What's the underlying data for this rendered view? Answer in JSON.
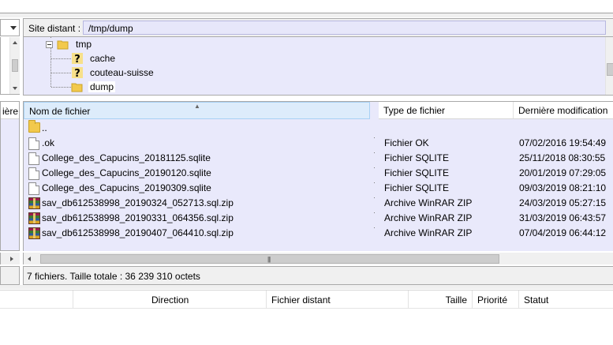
{
  "left_pane": {
    "list_header_partial": "ière"
  },
  "remote": {
    "site_label": "Site distant :",
    "path": "/tmp/dump",
    "tree": [
      {
        "label": "tmp",
        "icon": "folder-icon",
        "selected": false
      },
      {
        "label": "cache",
        "icon": "unknown-folder-icon",
        "selected": false
      },
      {
        "label": "couteau-suisse",
        "icon": "unknown-folder-icon",
        "selected": false
      },
      {
        "label": "dump",
        "icon": "folder-icon",
        "selected": true
      }
    ],
    "columns": {
      "name": "Nom de fichier",
      "type": "Type de fichier",
      "modified": "Dernière modification"
    },
    "files": [
      {
        "name": "..",
        "type": "",
        "modified": "",
        "icon": "folder-icon"
      },
      {
        "name": ".ok",
        "type": "Fichier OK",
        "modified": "07/02/2016 19:54:49",
        "icon": "file-icon"
      },
      {
        "name": "College_des_Capucins_20181125.sqlite",
        "type": "Fichier SQLITE",
        "modified": "25/11/2018 08:30:55",
        "icon": "file-icon"
      },
      {
        "name": "College_des_Capucins_20190120.sqlite",
        "type": "Fichier SQLITE",
        "modified": "20/01/2019 07:29:05",
        "icon": "file-icon"
      },
      {
        "name": "College_des_Capucins_20190309.sqlite",
        "type": "Fichier SQLITE",
        "modified": "09/03/2019 08:21:10",
        "icon": "file-icon"
      },
      {
        "name": "sav_db612538998_20190324_052713.sql.zip",
        "type": "Archive WinRAR ZIP",
        "modified": "24/03/2019 05:27:15",
        "icon": "winrar-zip-icon"
      },
      {
        "name": "sav_db612538998_20190331_064356.sql.zip",
        "type": "Archive WinRAR ZIP",
        "modified": "31/03/2019 06:43:57",
        "icon": "winrar-zip-icon"
      },
      {
        "name": "sav_db612538998_20190407_064410.sql.zip",
        "type": "Archive WinRAR ZIP",
        "modified": "07/04/2019 06:44:12",
        "icon": "winrar-zip-icon"
      }
    ],
    "status": "7 fichiers. Taille totale : 36 239 310 octets"
  },
  "queue": {
    "columns": [
      "Direction",
      "Fichier distant",
      "Taille",
      "Priorité",
      "Statut"
    ]
  },
  "colors": {
    "list_background": "#e9e9fb",
    "selected_header": "#ddecfb",
    "panel_gray": "#f0f0f0"
  }
}
